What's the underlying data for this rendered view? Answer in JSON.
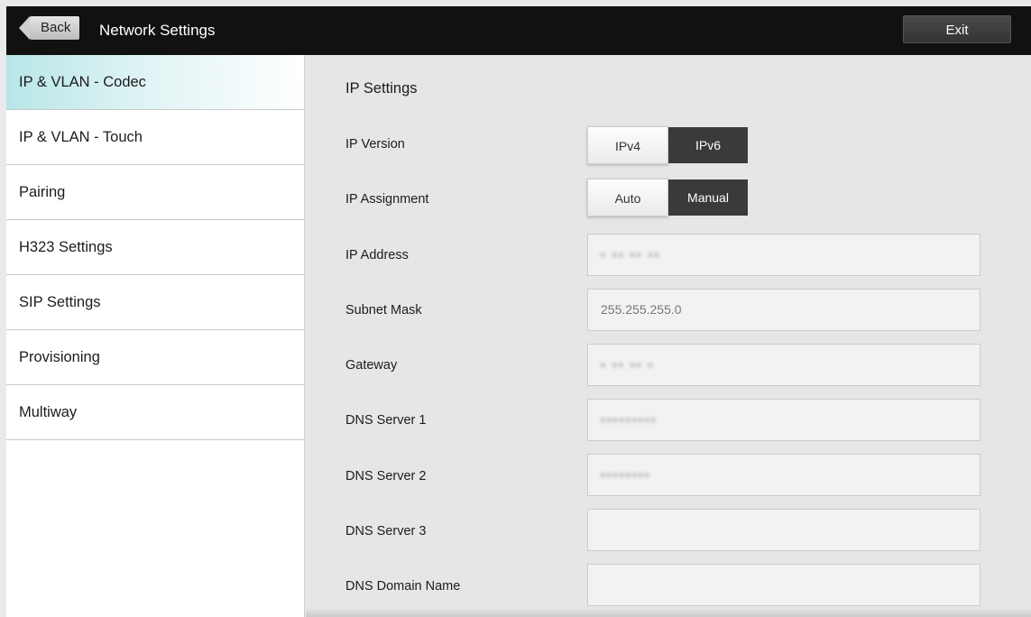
{
  "header": {
    "back_label": "Back",
    "title": "Network Settings",
    "exit_label": "Exit"
  },
  "sidebar": {
    "items": [
      {
        "label": "IP & VLAN - Codec",
        "active": true
      },
      {
        "label": "IP & VLAN - Touch"
      },
      {
        "label": "Pairing"
      },
      {
        "label": "H323 Settings"
      },
      {
        "label": "SIP Settings"
      },
      {
        "label": "Provisioning"
      },
      {
        "label": "Multiway"
      }
    ]
  },
  "main": {
    "section_title": "IP Settings",
    "ip_version": {
      "label": "IP Version",
      "options": [
        "IPv4",
        "IPv6"
      ],
      "selected": "IPv6"
    },
    "ip_assignment": {
      "label": "IP Assignment",
      "options": [
        "Auto",
        "Manual"
      ],
      "selected": "Manual"
    },
    "ip_address": {
      "label": "IP Address",
      "value": "▪ ▪▪ ▪▪ ▪▪"
    },
    "subnet_mask": {
      "label": "Subnet Mask",
      "value": "255.255.255.0"
    },
    "gateway": {
      "label": "Gateway",
      "value": "▪ ▪▪ ▪▪ ▪"
    },
    "dns_server_1": {
      "label": "DNS Server 1",
      "value": "▪▪▪▪▪▪▪▪▪"
    },
    "dns_server_2": {
      "label": "DNS Server 2",
      "value": "▪▪▪▪▪▪▪▪"
    },
    "dns_server_3": {
      "label": "DNS Server 3",
      "value": ""
    },
    "dns_domain_name": {
      "label": "DNS Domain Name",
      "value": ""
    }
  },
  "colors": {
    "header_bg": "#111111",
    "active_item": "#b7e6e8",
    "selected_segment": "#3a3a3a"
  }
}
